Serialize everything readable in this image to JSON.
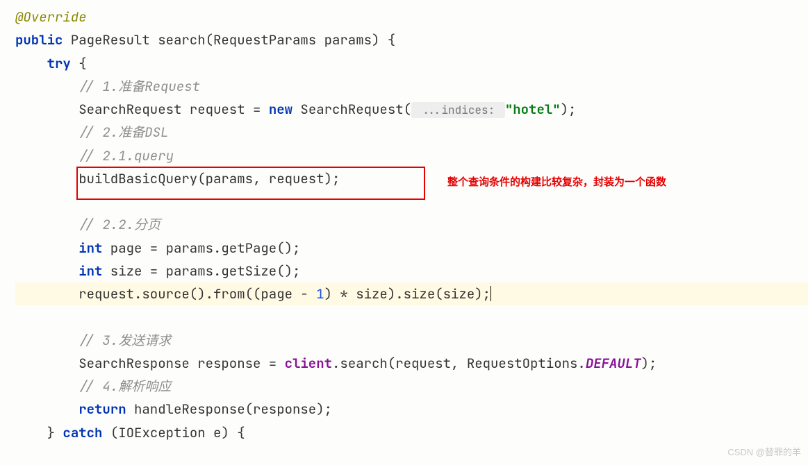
{
  "code": {
    "annotation": "@Override",
    "line2_public": "public",
    "line2_rest": " PageResult search(RequestParams params) {",
    "line3_try": "try",
    "line3_rest": " {",
    "comment1": "// 1.准备Request",
    "line5_a": "SearchRequest request = ",
    "line5_new": "new",
    "line5_b": " SearchRequest(",
    "line5_hint": " ...indices: ",
    "line5_string": "\"hotel\"",
    "line5_end": ");",
    "comment2": "// 2.准备DSL",
    "comment3": "// 2.1.query",
    "line8": "buildBasicQuery(params, request);",
    "comment4": "// 2.2.分页",
    "line11_int1": "int",
    "line11_rest": " page = params.getPage();",
    "line12_int2": "int",
    "line12_rest": " size = params.getSize();",
    "line13_a": "request.source().from((page - ",
    "line13_num": "1",
    "line13_b": ") * size).size(size);",
    "comment5": "// 3.发送请求",
    "line16_a": "SearchResponse response = ",
    "line16_client": "client",
    "line16_b": ".search(request, RequestOptions.",
    "line16_default": "DEFAULT",
    "line16_end": ");",
    "comment6": "// 4.解析响应",
    "line18_return": "return",
    "line18_rest": " handleResponse(response);",
    "line19_a": "} ",
    "line19_catch": "catch",
    "line19_b": " (IOException e) {"
  },
  "annotation_text": "整个查询条件的构建比较复杂，封装为一个函数",
  "watermark": "CSDN @替罪的羊"
}
